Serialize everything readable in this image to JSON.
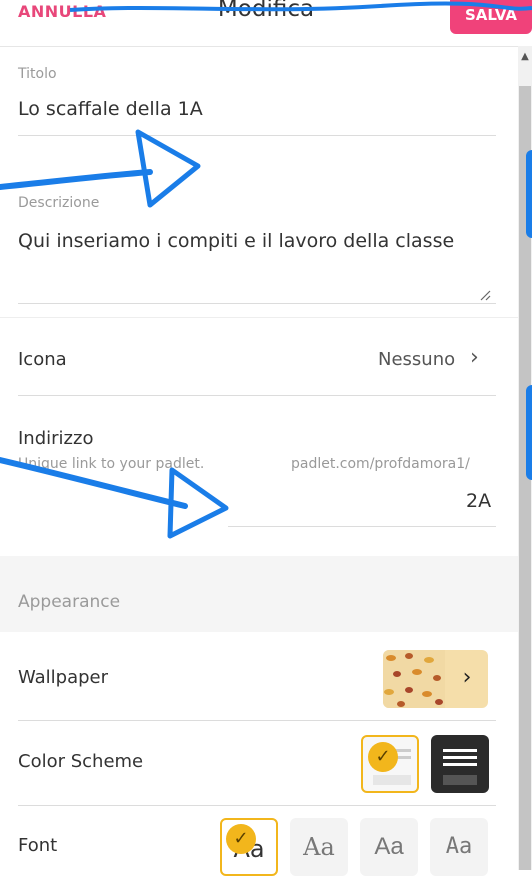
{
  "header": {
    "cancel_label": "ANNULLA",
    "title": "Modifica",
    "save_label": "SALVA"
  },
  "form": {
    "title": {
      "label": "Titolo",
      "value": "Lo scaffale della 1A"
    },
    "description": {
      "label": "Descrizione",
      "value": "Qui inseriamo i compiti e il lavoro della classe"
    },
    "icon": {
      "label": "Icona",
      "value": "Nessuno"
    },
    "address": {
      "label": "Indirizzo",
      "hint": "Unique link to your padlet.",
      "prefix": "padlet.com/profdamora1/",
      "value": "2A"
    }
  },
  "appearance": {
    "section_label": "Appearance",
    "wallpaper_label": "Wallpaper",
    "color_scheme_label": "Color Scheme",
    "font_label": "Font",
    "font_samples": [
      "Aa",
      "Aa",
      "Aa",
      "Aa"
    ]
  },
  "icons": {
    "chevron": "›",
    "check": "✓"
  },
  "colors": {
    "accent": "#f0427a",
    "annotation_blue": "#1a7de8",
    "selected_check": "#f2b61c"
  }
}
